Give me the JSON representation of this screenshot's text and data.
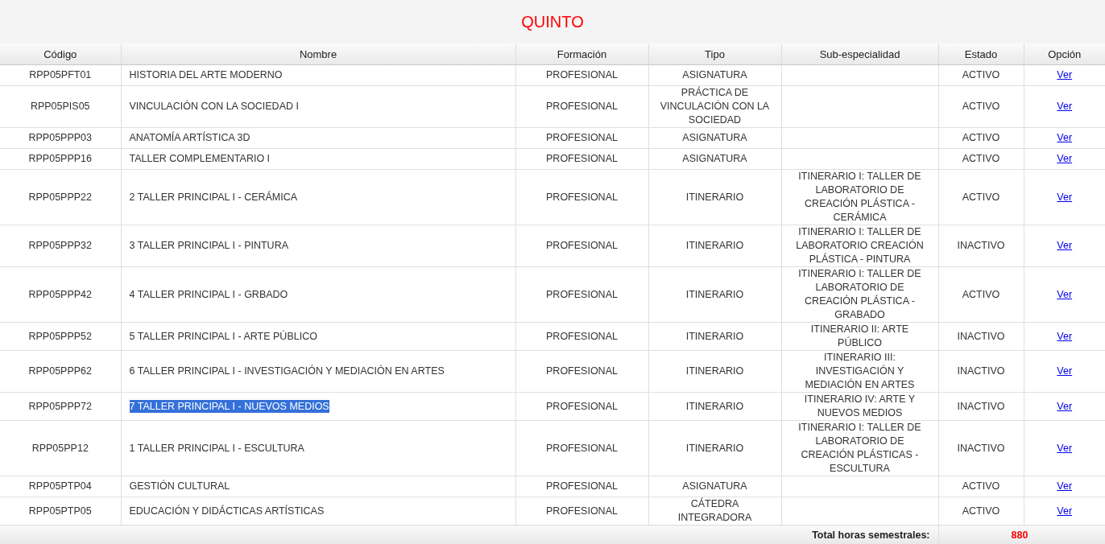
{
  "title": "QUINTO",
  "columns": [
    "Código",
    "Nombre",
    "Formación",
    "Tipo",
    "Sub-especialidad",
    "Estado",
    "Opción"
  ],
  "rows": [
    {
      "code": "RPP05PFT01",
      "name": "HISTORIA DEL ARTE MODERNO",
      "formation": "PROFESIONAL",
      "type": "ASIGNATURA",
      "sub": "",
      "status": "ACTIVO",
      "option": "Ver",
      "text_selected": false
    },
    {
      "code": "RPP05PIS05",
      "name": "VINCULACIÓN CON LA SOCIEDAD I",
      "formation": "PROFESIONAL",
      "type": "PRÁCTICA DE VINCULACIÓN CON LA SOCIEDAD",
      "sub": "",
      "status": "ACTIVO",
      "option": "Ver",
      "text_selected": false
    },
    {
      "code": "RPP05PPP03",
      "name": "ANATOMÍA ARTÍSTICA 3D",
      "formation": "PROFESIONAL",
      "type": "ASIGNATURA",
      "sub": "",
      "status": "ACTIVO",
      "option": "Ver",
      "text_selected": false
    },
    {
      "code": "RPP05PPP16",
      "name": "TALLER COMPLEMENTARIO I",
      "formation": "PROFESIONAL",
      "type": "ASIGNATURA",
      "sub": "",
      "status": "ACTIVO",
      "option": "Ver",
      "text_selected": false
    },
    {
      "code": "RPP05PPP22",
      "name": "2 TALLER PRINCIPAL I - CERÁMICA",
      "formation": "PROFESIONAL",
      "type": "ITINERARIO",
      "sub": "ITINERARIO I: TALLER DE LABORATORIO DE CREACIÓN PLÁSTICA - CERÁMICA",
      "status": "ACTIVO",
      "option": "Ver",
      "text_selected": false
    },
    {
      "code": "RPP05PPP32",
      "name": "3 TALLER PRINCIPAL I - PINTURA",
      "formation": "PROFESIONAL",
      "type": "ITINERARIO",
      "sub": "ITINERARIO I: TALLER DE LABORATORIO CREACIÓN PLÁSTICA - PINTURA",
      "status": "INACTIVO",
      "option": "Ver",
      "text_selected": false
    },
    {
      "code": "RPP05PPP42",
      "name": "4 TALLER PRINCIPAL I - GRBADO",
      "formation": "PROFESIONAL",
      "type": "ITINERARIO",
      "sub": "ITINERARIO I: TALLER DE LABORATORIO DE CREACIÓN PLÁSTICA - GRABADO",
      "status": "ACTIVO",
      "option": "Ver",
      "text_selected": false
    },
    {
      "code": "RPP05PPP52",
      "name": "5 TALLER PRINCIPAL I - ARTE PÚBLICO",
      "formation": "PROFESIONAL",
      "type": "ITINERARIO",
      "sub": "ITINERARIO II: ARTE PÚBLICO",
      "status": "INACTIVO",
      "option": "Ver",
      "text_selected": false
    },
    {
      "code": "RPP05PPP62",
      "name": "6 TALLER PRINCIPAL I - INVESTIGACIÓN Y MEDIACIÓN EN ARTES",
      "formation": "PROFESIONAL",
      "type": "ITINERARIO",
      "sub": "ITINERARIO III: INVESTIGACIÓN Y MEDIACIÓN EN ARTES",
      "status": "INACTIVO",
      "option": "Ver",
      "text_selected": false
    },
    {
      "code": "RPP05PPP72",
      "name": "7 TALLER PRINCIPAL I - NUEVOS MEDIOS",
      "formation": "PROFESIONAL",
      "type": "ITINERARIO",
      "sub": "ITINERARIO IV: ARTE Y NUEVOS MEDIOS",
      "status": "INACTIVO",
      "option": "Ver",
      "text_selected": true
    },
    {
      "code": "RPP05PP12",
      "name": "1 TALLER PRINCIPAL I - ESCULTURA",
      "formation": "PROFESIONAL",
      "type": "ITINERARIO",
      "sub": "ITINERARIO I: TALLER DE LABORATORIO DE CREACIÓN PLÁSTICAS - ESCULTURA",
      "status": "INACTIVO",
      "option": "Ver",
      "text_selected": false
    },
    {
      "code": "RPP05PTP04",
      "name": "GESTIÓN CULTURAL",
      "formation": "PROFESIONAL",
      "type": "ASIGNATURA",
      "sub": "",
      "status": "ACTIVO",
      "option": "Ver",
      "text_selected": false
    },
    {
      "code": "RPP05PTP05",
      "name": "EDUCACIÓN Y DIDÁCTICAS ARTÍSTICAS",
      "formation": "PROFESIONAL",
      "type": "CÁTEDRA INTEGRADORA",
      "sub": "",
      "status": "ACTIVO",
      "option": "Ver",
      "text_selected": false
    }
  ],
  "footer": {
    "label": "Total horas semestrales:",
    "value": "880"
  }
}
